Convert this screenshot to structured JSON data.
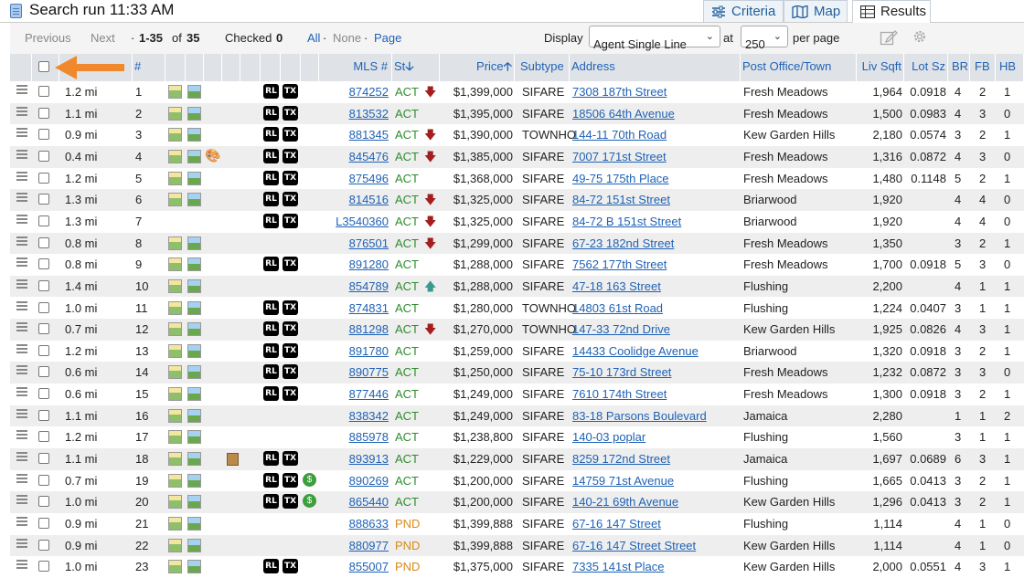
{
  "header": {
    "title": "Search run 11:33 AM"
  },
  "tabs": [
    {
      "label": "Criteria",
      "icon": "sliders-icon"
    },
    {
      "label": "Map",
      "icon": "map-icon"
    },
    {
      "label": "Results",
      "icon": "table-icon"
    }
  ],
  "toolbar": {
    "previous": "Previous",
    "next": "Next",
    "range_sep": "·",
    "range": "1-35",
    "of": "of",
    "total": "35",
    "checked_label": "Checked",
    "checked_count": "0",
    "all": "All",
    "none": "None",
    "page": "Page",
    "display_label": "Display",
    "display_value": "Agent Single Line",
    "at": "at",
    "per_page_value": "250",
    "per_page_label": "per page",
    "sep1": "·",
    "sep2": "·"
  },
  "columns": {
    "num": "#",
    "mls": "MLS #",
    "st": "St",
    "price": "Price",
    "subtype": "Subtype",
    "address": "Address",
    "po": "Post Office/Town",
    "livsqft": "Liv Sqft",
    "lotsz": "Lot Sz",
    "br": "BR",
    "fb": "FB",
    "hb": "HB"
  },
  "rows": [
    {
      "dist": "1.2 mi",
      "n": "1",
      "rl": true,
      "tx": true,
      "extra": "",
      "mls": "874252",
      "st": "ACT",
      "arr": "down",
      "price": "$1,399,000",
      "sub": "SIFARE",
      "addr": "7308 187th Street",
      "po": "Fresh Meadows",
      "sq": "1,964",
      "lot": "0.0918",
      "br": "4",
      "fb": "2",
      "hb": "1"
    },
    {
      "dist": "1.1 mi",
      "n": "2",
      "rl": true,
      "tx": true,
      "extra": "",
      "mls": "813532",
      "st": "ACT",
      "arr": "",
      "price": "$1,395,000",
      "sub": "SIFARE",
      "addr": "18506 64th Avenue",
      "po": "Fresh Meadows",
      "sq": "1,500",
      "lot": "0.0983",
      "br": "4",
      "fb": "3",
      "hb": "0"
    },
    {
      "dist": "0.9 mi",
      "n": "3",
      "rl": true,
      "tx": true,
      "extra": "",
      "mls": "881345",
      "st": "ACT",
      "arr": "down",
      "price": "$1,390,000",
      "sub": "TOWNHO",
      "addr": "144-11 70th Road",
      "po": "Kew Garden Hills",
      "sq": "2,180",
      "lot": "0.0574",
      "br": "3",
      "fb": "2",
      "hb": "1"
    },
    {
      "dist": "0.4 mi",
      "n": "4",
      "rl": true,
      "tx": true,
      "extra": "palette",
      "mls": "845476",
      "st": "ACT",
      "arr": "down",
      "price": "$1,385,000",
      "sub": "SIFARE",
      "addr": "7007 171st Street",
      "po": "Fresh Meadows",
      "sq": "1,316",
      "lot": "0.0872",
      "br": "4",
      "fb": "3",
      "hb": "0"
    },
    {
      "dist": "1.2 mi",
      "n": "5",
      "rl": true,
      "tx": true,
      "extra": "",
      "mls": "875496",
      "st": "ACT",
      "arr": "",
      "price": "$1,368,000",
      "sub": "SIFARE",
      "addr": "49-75 175th Place",
      "po": "Fresh Meadows",
      "sq": "1,480",
      "lot": "0.1148",
      "br": "5",
      "fb": "2",
      "hb": "1"
    },
    {
      "dist": "1.3 mi",
      "n": "6",
      "rl": true,
      "tx": true,
      "extra": "",
      "mls": "814516",
      "st": "ACT",
      "arr": "down",
      "price": "$1,325,000",
      "sub": "SIFARE",
      "addr": "84-72 151st Street",
      "po": "Briarwood",
      "sq": "1,920",
      "lot": "",
      "br": "4",
      "fb": "4",
      "hb": "0"
    },
    {
      "dist": "1.3 mi",
      "n": "7",
      "rl": true,
      "tx": true,
      "extra": "",
      "mls": "L3540360",
      "st": "ACT",
      "arr": "down",
      "price": "$1,325,000",
      "sub": "SIFARE",
      "addr": "84-72 B 151st Street",
      "po": "Briarwood",
      "sq": "1,920",
      "lot": "",
      "br": "4",
      "fb": "4",
      "hb": "0",
      "nophoto": true
    },
    {
      "dist": "0.8 mi",
      "n": "8",
      "rl": false,
      "tx": false,
      "extra": "",
      "mls": "876501",
      "st": "ACT",
      "arr": "down",
      "price": "$1,299,000",
      "sub": "SIFARE",
      "addr": "67-23 182nd Street",
      "po": "Fresh Meadows",
      "sq": "1,350",
      "lot": "",
      "br": "3",
      "fb": "2",
      "hb": "1"
    },
    {
      "dist": "0.8 mi",
      "n": "9",
      "rl": true,
      "tx": true,
      "extra": "",
      "mls": "891280",
      "st": "ACT",
      "arr": "",
      "price": "$1,288,000",
      "sub": "SIFARE",
      "addr": "7562 177th Street",
      "po": "Fresh Meadows",
      "sq": "1,700",
      "lot": "0.0918",
      "br": "5",
      "fb": "3",
      "hb": "0"
    },
    {
      "dist": "1.4 mi",
      "n": "10",
      "rl": false,
      "tx": false,
      "extra": "",
      "mls": "854789",
      "st": "ACT",
      "arr": "up",
      "price": "$1,288,000",
      "sub": "SIFARE",
      "addr": "47-18 163 Street",
      "po": "Flushing",
      "sq": "2,200",
      "lot": "",
      "br": "4",
      "fb": "1",
      "hb": "1"
    },
    {
      "dist": "1.0 mi",
      "n": "11",
      "rl": true,
      "tx": true,
      "extra": "",
      "mls": "874831",
      "st": "ACT",
      "arr": "",
      "price": "$1,280,000",
      "sub": "TOWNHO",
      "addr": "14803 61st Road",
      "po": "Flushing",
      "sq": "1,224",
      "lot": "0.0407",
      "br": "3",
      "fb": "1",
      "hb": "1"
    },
    {
      "dist": "0.7 mi",
      "n": "12",
      "rl": true,
      "tx": true,
      "extra": "",
      "mls": "881298",
      "st": "ACT",
      "arr": "down",
      "price": "$1,270,000",
      "sub": "TOWNHO",
      "addr": "147-33 72nd Drive",
      "po": "Kew Garden Hills",
      "sq": "1,925",
      "lot": "0.0826",
      "br": "4",
      "fb": "3",
      "hb": "1"
    },
    {
      "dist": "1.2 mi",
      "n": "13",
      "rl": true,
      "tx": true,
      "extra": "",
      "mls": "891780",
      "st": "ACT",
      "arr": "",
      "price": "$1,259,000",
      "sub": "SIFARE",
      "addr": "14433 Coolidge Avenue",
      "po": "Briarwood",
      "sq": "1,320",
      "lot": "0.0918",
      "br": "3",
      "fb": "2",
      "hb": "1"
    },
    {
      "dist": "0.6 mi",
      "n": "14",
      "rl": true,
      "tx": true,
      "extra": "",
      "mls": "890775",
      "st": "ACT",
      "arr": "",
      "price": "$1,250,000",
      "sub": "SIFARE",
      "addr": "75-10 173rd Street",
      "po": "Fresh Meadows",
      "sq": "1,232",
      "lot": "0.0872",
      "br": "3",
      "fb": "3",
      "hb": "0"
    },
    {
      "dist": "0.6 mi",
      "n": "15",
      "rl": true,
      "tx": true,
      "extra": "",
      "mls": "877446",
      "st": "ACT",
      "arr": "",
      "price": "$1,249,000",
      "sub": "SIFARE",
      "addr": "7610 174th Street",
      "po": "Fresh Meadows",
      "sq": "1,300",
      "lot": "0.0918",
      "br": "3",
      "fb": "2",
      "hb": "1"
    },
    {
      "dist": "1.1 mi",
      "n": "16",
      "rl": false,
      "tx": false,
      "extra": "",
      "mls": "838342",
      "st": "ACT",
      "arr": "",
      "price": "$1,249,000",
      "sub": "SIFARE",
      "addr": "83-18 Parsons Boulevard",
      "po": "Jamaica",
      "sq": "2,280",
      "lot": "",
      "br": "1",
      "fb": "1",
      "hb": "2"
    },
    {
      "dist": "1.2 mi",
      "n": "17",
      "rl": false,
      "tx": false,
      "extra": "",
      "mls": "885978",
      "st": "ACT",
      "arr": "",
      "price": "$1,238,800",
      "sub": "SIFARE",
      "addr": "140-03 poplar",
      "po": "Flushing",
      "sq": "1,560",
      "lot": "",
      "br": "3",
      "fb": "1",
      "hb": "1"
    },
    {
      "dist": "1.1 mi",
      "n": "18",
      "rl": true,
      "tx": true,
      "extra": "door",
      "mls": "893913",
      "st": "ACT",
      "arr": "",
      "price": "$1,229,000",
      "sub": "SIFARE",
      "addr": "8259 172nd Street",
      "po": "Jamaica",
      "sq": "1,697",
      "lot": "0.0689",
      "br": "6",
      "fb": "3",
      "hb": "1"
    },
    {
      "dist": "0.7 mi",
      "n": "19",
      "rl": true,
      "tx": true,
      "extra": "coin",
      "mls": "890269",
      "st": "ACT",
      "arr": "",
      "price": "$1,200,000",
      "sub": "SIFARE",
      "addr": "14759 71st Avenue",
      "po": "Flushing",
      "sq": "1,665",
      "lot": "0.0413",
      "br": "3",
      "fb": "2",
      "hb": "1"
    },
    {
      "dist": "1.0 mi",
      "n": "20",
      "rl": true,
      "tx": true,
      "extra": "coin",
      "mls": "865440",
      "st": "ACT",
      "arr": "",
      "price": "$1,200,000",
      "sub": "SIFARE",
      "addr": "140-21 69th Avenue",
      "po": "Kew Garden Hills",
      "sq": "1,296",
      "lot": "0.0413",
      "br": "3",
      "fb": "2",
      "hb": "1"
    },
    {
      "dist": "0.9 mi",
      "n": "21",
      "rl": false,
      "tx": false,
      "extra": "",
      "mls": "888633",
      "st": "PND",
      "arr": "",
      "price": "$1,399,888",
      "sub": "SIFARE",
      "addr": "67-16 147 Street",
      "po": "Flushing",
      "sq": "1,114",
      "lot": "",
      "br": "4",
      "fb": "1",
      "hb": "0"
    },
    {
      "dist": "0.9 mi",
      "n": "22",
      "rl": false,
      "tx": false,
      "extra": "",
      "mls": "880977",
      "st": "PND",
      "arr": "",
      "price": "$1,399,888",
      "sub": "SIFARE",
      "addr": "67-16 147 Street Street",
      "po": "Kew Garden Hills",
      "sq": "1,114",
      "lot": "",
      "br": "4",
      "fb": "1",
      "hb": "0"
    },
    {
      "dist": "1.0 mi",
      "n": "23",
      "rl": true,
      "tx": true,
      "extra": "",
      "mls": "855007",
      "st": "PND",
      "arr": "",
      "price": "$1,375,000",
      "sub": "SIFARE",
      "addr": "7335 141st Place",
      "po": "Kew Garden Hills",
      "sq": "2,000",
      "lot": "0.0551",
      "br": "4",
      "fb": "3",
      "hb": "1"
    }
  ],
  "badges": {
    "rl": "RL",
    "tx": "TX",
    "coin": "$"
  },
  "colors": {
    "accent": "#1f62b5",
    "active": "#2e8b2e",
    "pending": "#d98a1a",
    "down_arrow": "#a31f1f",
    "up_arrow": "#3a9a8f",
    "header_bg": "#dfe3e8",
    "pointer_arrow": "#f0892b"
  }
}
